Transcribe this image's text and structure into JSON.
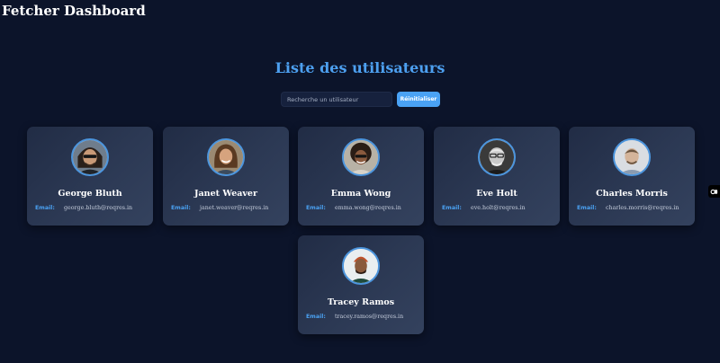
{
  "app": {
    "title": "Fetcher Dashboard"
  },
  "main": {
    "heading": "Liste des utilisateurs",
    "search": {
      "placeholder": "Recherche un utilisateur",
      "value": ""
    },
    "reset_label": "Réinitialiser",
    "email_label": "Email:",
    "users": [
      {
        "name": "George Bluth",
        "email": "george.bluth@reqres.in"
      },
      {
        "name": "Janet Weaver",
        "email": "janet.weaver@reqres.in"
      },
      {
        "name": "Emma Wong",
        "email": "emma.wong@reqres.in"
      },
      {
        "name": "Eve Holt",
        "email": "eve.holt@reqres.in"
      },
      {
        "name": "Charles Morris",
        "email": "charles.morris@reqres.in"
      },
      {
        "name": "Tracey Ramos",
        "email": "tracey.ramos@reqres.in"
      }
    ]
  },
  "side_widget": {
    "icon": "floating-toggle-icon"
  },
  "colors": {
    "background": "#0c142a",
    "accent": "#4aa2f4",
    "heading": "#4da0f0",
    "avatar_border": "#4c95dd"
  }
}
